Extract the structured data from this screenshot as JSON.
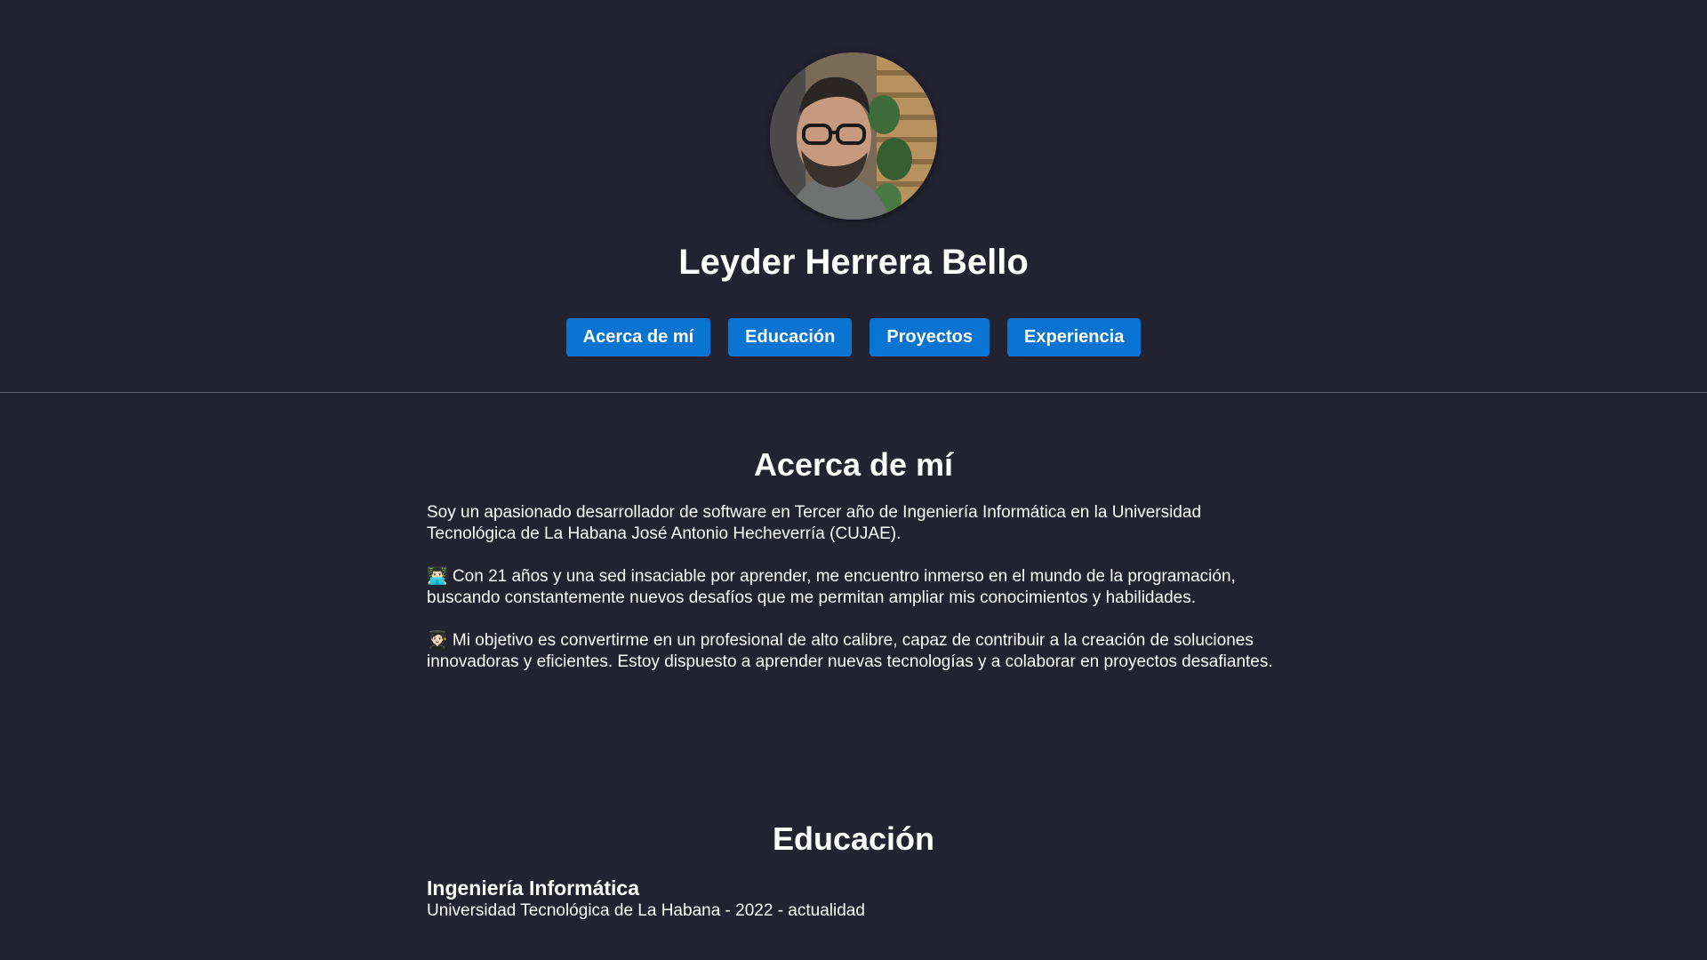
{
  "profile": {
    "name": "Leyder Herrera Bello",
    "avatar_alt": "profile-photo"
  },
  "nav": {
    "items": [
      {
        "label": "Acerca de mí"
      },
      {
        "label": "Educación"
      },
      {
        "label": "Proyectos"
      },
      {
        "label": "Experiencia"
      }
    ]
  },
  "about": {
    "title": "Acerca de mí",
    "paragraphs": [
      "Soy un apasionado desarrollador de software en Tercer año de Ingeniería Informática en la Universidad Tecnológica de La Habana José Antonio Hecheverría (CUJAE).",
      "👨🏻‍💻 Con 21 años y una sed insaciable por aprender, me encuentro inmerso en el mundo de la programación, buscando constantemente nuevos desafíos que me permitan ampliar mis conocimientos y habilidades.",
      "🧑🏻‍🎓 Mi objetivo es convertirme en un profesional de alto calibre, capaz de contribuir a la creación de soluciones innovadoras y eficientes. Estoy dispuesto a aprender nuevas tecnologías y a colaborar en proyectos desafiantes."
    ]
  },
  "education": {
    "title": "Educación",
    "entries": [
      {
        "degree": "Ingeniería Informática",
        "details": "Universidad Tecnológica de La Habana - 2022 - actualidad"
      }
    ]
  },
  "colors": {
    "background": "#232230",
    "button": "#0a74d2",
    "text": "#ffffff",
    "divider": "#5e5d6a"
  }
}
